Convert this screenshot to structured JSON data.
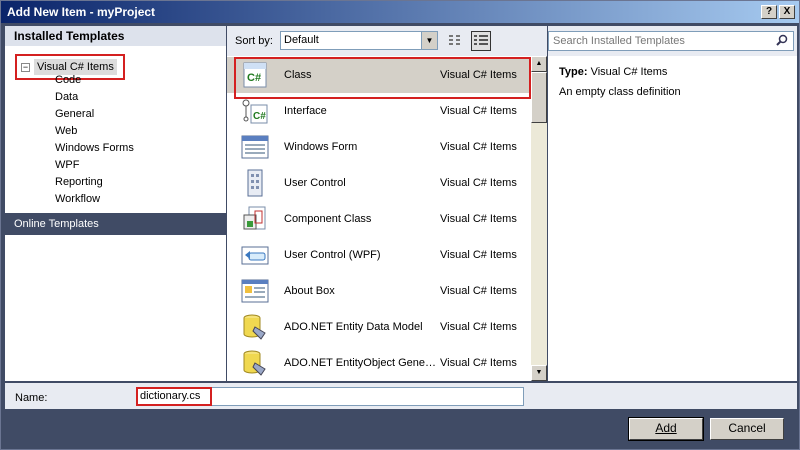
{
  "window": {
    "title": "Add New Item - myProject",
    "help_label": "?",
    "close_label": "X"
  },
  "left": {
    "header": "Installed Templates",
    "root": {
      "expander": "−",
      "label": "Visual C# Items"
    },
    "children": [
      "Code",
      "Data",
      "General",
      "Web",
      "Windows Forms",
      "WPF",
      "Reporting",
      "Workflow"
    ],
    "online": "Online Templates"
  },
  "sort": {
    "label": "Sort by:",
    "value": "Default"
  },
  "templates": [
    {
      "name": "Class",
      "category": "Visual C# Items",
      "icon": "class-icon"
    },
    {
      "name": "Interface",
      "category": "Visual C# Items",
      "icon": "interface-icon"
    },
    {
      "name": "Windows Form",
      "category": "Visual C# Items",
      "icon": "windows-form-icon"
    },
    {
      "name": "User Control",
      "category": "Visual C# Items",
      "icon": "user-control-icon"
    },
    {
      "name": "Component Class",
      "category": "Visual C# Items",
      "icon": "component-class-icon"
    },
    {
      "name": "User Control (WPF)",
      "category": "Visual C# Items",
      "icon": "user-control-wpf-icon"
    },
    {
      "name": "About Box",
      "category": "Visual C# Items",
      "icon": "about-box-icon"
    },
    {
      "name": "ADO.NET Entity Data Model",
      "category": "Visual C# Items",
      "icon": "entity-data-model-icon"
    },
    {
      "name": "ADO.NET EntityObject Genera...",
      "category": "Visual C# Items",
      "icon": "entityobject-generator-icon"
    }
  ],
  "search": {
    "placeholder": "Search Installed Templates"
  },
  "details": {
    "type_label": "Type:",
    "type_value": "Visual C# Items",
    "description": "An empty class definition"
  },
  "name_field": {
    "label": "Name:",
    "value": "dictionary.cs"
  },
  "buttons": {
    "add": "Add",
    "cancel": "Cancel"
  },
  "colors": {
    "highlight": "#d42020",
    "title_start": "#0a246a",
    "panel_dark": "#404b65"
  }
}
